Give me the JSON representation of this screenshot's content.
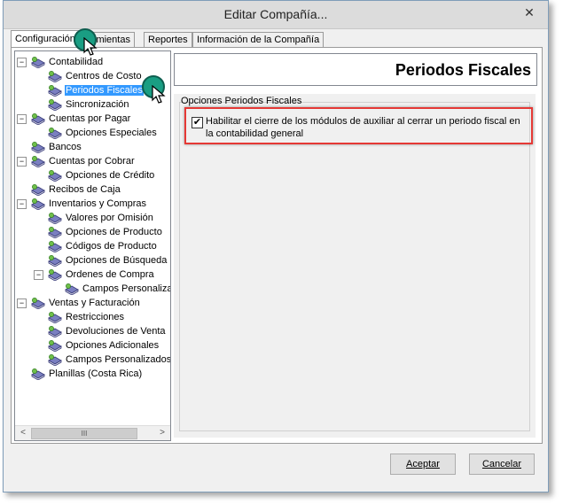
{
  "window": {
    "title": "Editar Compañía...",
    "close_glyph": "✕"
  },
  "tabs": [
    {
      "label": "Configuración",
      "active": true
    },
    {
      "label": "rramientas"
    },
    {
      "label": "Reportes"
    },
    {
      "label": "Información de la Compañía"
    }
  ],
  "tree": {
    "items": [
      {
        "label": "Contabilidad",
        "expander": "−"
      },
      {
        "label": "Centros de Costo"
      },
      {
        "label": "Periodos Fiscales",
        "selected": true
      },
      {
        "label": "Sincronización"
      },
      {
        "label": "Cuentas por Pagar",
        "expander": "−"
      },
      {
        "label": "Opciones Especiales"
      },
      {
        "label": "Bancos"
      },
      {
        "label": "Cuentas por Cobrar",
        "expander": "−"
      },
      {
        "label": "Opciones de Crédito"
      },
      {
        "label": "Recibos de Caja"
      },
      {
        "label": "Inventarios y Compras",
        "expander": "−"
      },
      {
        "label": "Valores por Omisión"
      },
      {
        "label": "Opciones de Producto"
      },
      {
        "label": "Códigos de Producto"
      },
      {
        "label": "Opciones de Búsqueda"
      },
      {
        "label": "Ordenes de Compra",
        "expander": "−"
      },
      {
        "label": "Campos Personaliza"
      },
      {
        "label": "Ventas y Facturación",
        "expander": "−"
      },
      {
        "label": "Restricciones"
      },
      {
        "label": "Devoluciones de Venta"
      },
      {
        "label": "Opciones Adicionales"
      },
      {
        "label": "Campos Personalizados"
      },
      {
        "label": "Planillas (Costa Rica)"
      }
    ],
    "scrollbar": {
      "left_arrow": "<",
      "right_arrow": ">",
      "thumb_grip": "III"
    }
  },
  "panel": {
    "title": "Periodos Fiscales",
    "group_label": "Opciones Periodos Fiscales",
    "checkbox": {
      "checked": true,
      "check_glyph": "✔",
      "label": "Habilitar el cierre de los módulos de auxiliar al cerrar un periodo fiscal en la contabilidad general"
    }
  },
  "buttons": {
    "accept": "Aceptar",
    "cancel": "Cancelar"
  },
  "colors": {
    "selection": "#3399ff",
    "highlight": "#e53935",
    "marker": "#1a9e83"
  }
}
